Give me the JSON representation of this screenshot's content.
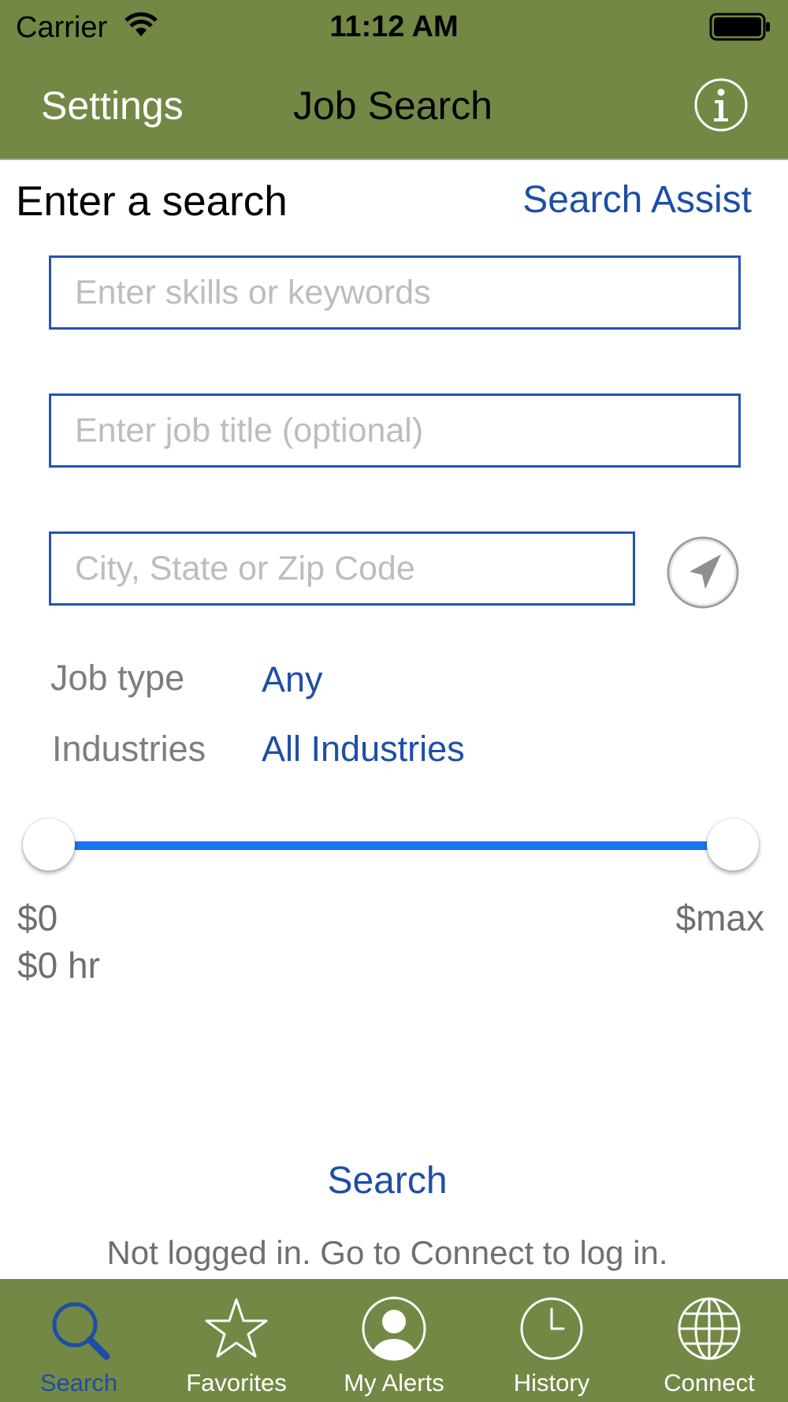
{
  "status_bar": {
    "carrier": "Carrier",
    "time": "11:12 AM"
  },
  "nav": {
    "left_button": "Settings",
    "title": "Job Search",
    "right_icon": "info-icon"
  },
  "search": {
    "heading": "Enter a search",
    "assist_link": "Search Assist",
    "keywords_placeholder": "Enter skills or keywords",
    "job_title_placeholder": "Enter job title (optional)",
    "location_placeholder": "City, State or Zip Code",
    "location_icon": "location-arrow-icon"
  },
  "filters": {
    "job_type_label": "Job type",
    "job_type_value": "Any",
    "industries_label": "Industries",
    "industries_value": "All Industries"
  },
  "salary": {
    "min_label": "$0",
    "max_label": "$max",
    "hourly_label": "$0 hr",
    "range_min_fraction": 0,
    "range_max_fraction": 1
  },
  "actions": {
    "search_button": "Search",
    "login_message": "Not logged in. Go to Connect to log in."
  },
  "tabs": [
    {
      "label": "Search",
      "icon": "search-icon",
      "active": true
    },
    {
      "label": "Favorites",
      "icon": "star-icon",
      "active": false
    },
    {
      "label": "My Alerts",
      "icon": "user-icon",
      "active": false
    },
    {
      "label": "History",
      "icon": "clock-icon",
      "active": false
    },
    {
      "label": "Connect",
      "icon": "globe-icon",
      "active": false
    }
  ],
  "colors": {
    "bar": "#738845",
    "accent": "#1e4ea6",
    "slider": "#1877f2"
  }
}
